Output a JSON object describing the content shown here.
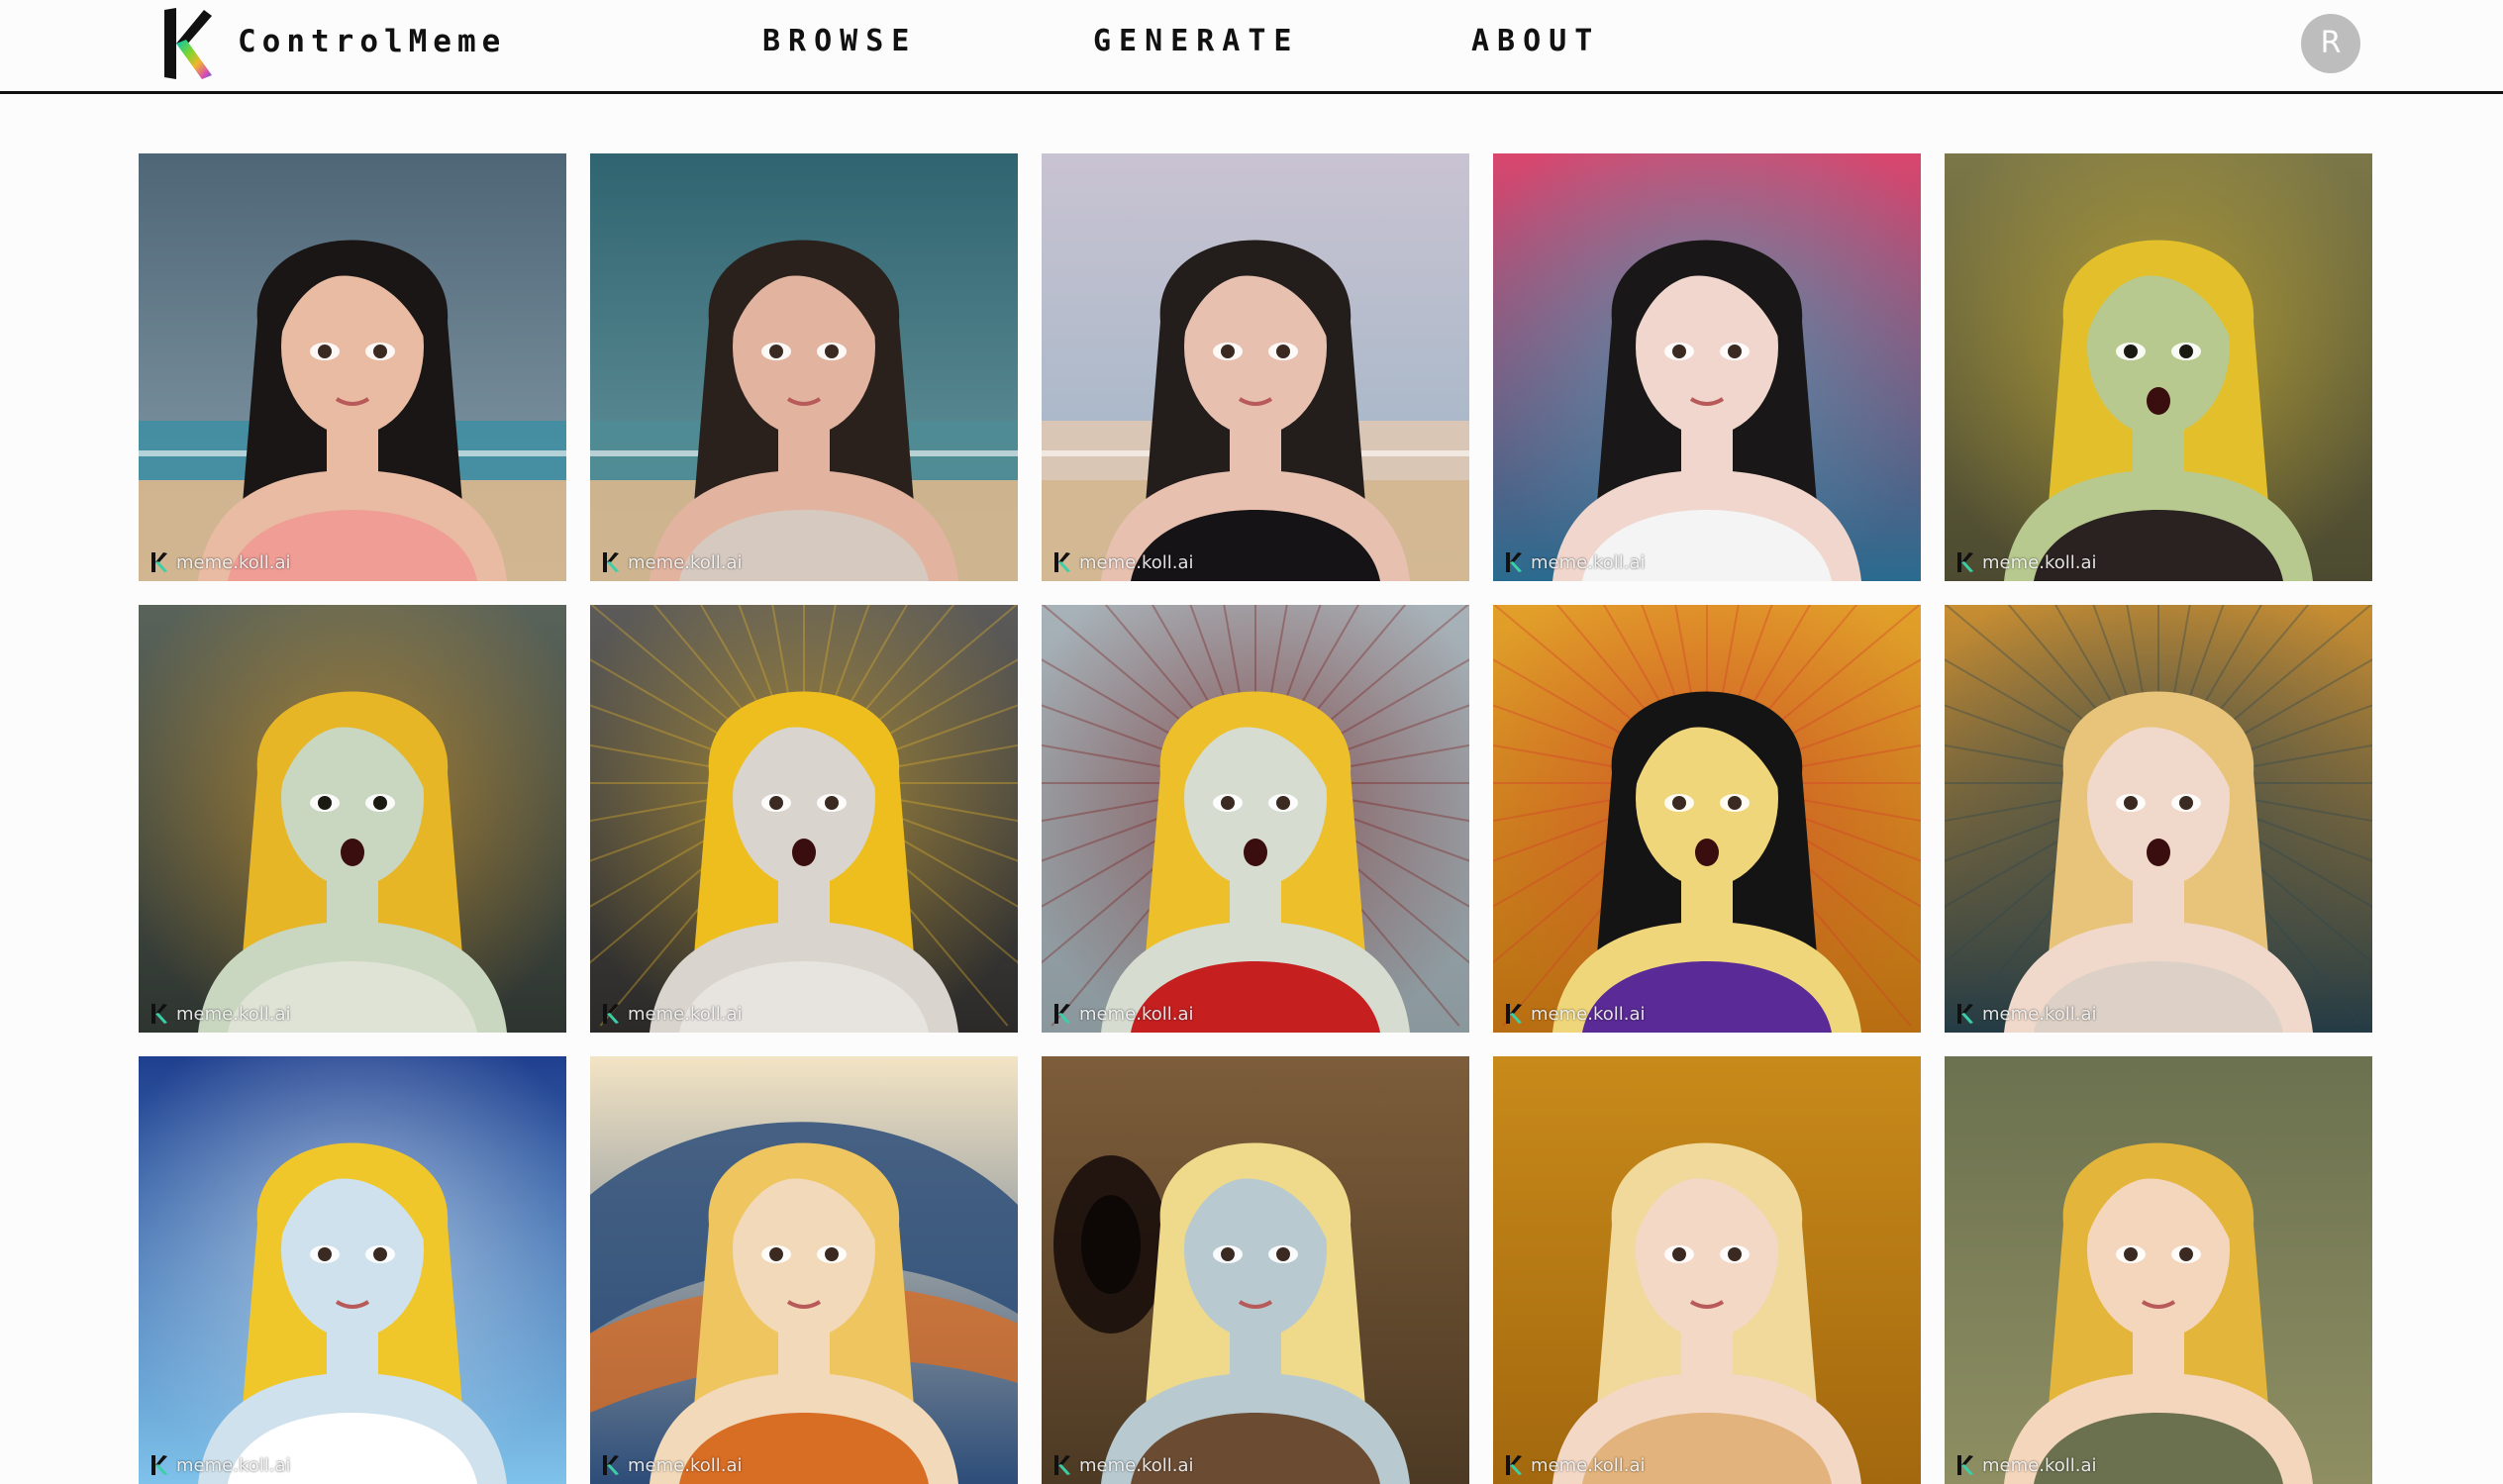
{
  "header": {
    "brand": "ControlMeme",
    "nav": [
      "BROWSE",
      "GENERATE",
      "ABOUT"
    ],
    "avatar_initial": "R"
  },
  "gallery": {
    "watermark": "meme.koll.ai",
    "items": [
      {
        "bg_top": "#4f6677",
        "bg_bottom": "#8aa0ad",
        "skin": "#e8bba2",
        "hair": "#1a1616",
        "shirt": "#ef9d95",
        "accent": "#3a8fa3",
        "scene": "beach"
      },
      {
        "bg_top": "#2f6470",
        "bg_bottom": "#6c9aa1",
        "skin": "#e2b49f",
        "hair": "#2a211d",
        "shirt": "#d6c9bf",
        "accent": "#4e8c95",
        "scene": "beach"
      },
      {
        "bg_top": "#c9c3d2",
        "bg_bottom": "#9ab3c4",
        "skin": "#e7c0b0",
        "hair": "#231d1b",
        "shirt": "#161316",
        "accent": "#e6c9b0",
        "scene": "beach"
      },
      {
        "bg_top": "#d9466e",
        "bg_bottom": "#2a6b8f",
        "skin": "#f0d6cc",
        "hair": "#1a1718",
        "shirt": "#f4f4f4",
        "accent": "#37b3c9",
        "scene": "studio"
      },
      {
        "bg_top": "#7b7748",
        "bg_bottom": "#4c4a30",
        "skin": "#b7c98e",
        "hair": "#e3c02b",
        "shirt": "#2a2220",
        "accent": "#e3c02b",
        "scene": "zombie"
      },
      {
        "bg_top": "#59635a",
        "bg_bottom": "#2e3530",
        "skin": "#c9d6c0",
        "hair": "#e7b626",
        "shirt": "#dfe3d6",
        "accent": "#f0a31f",
        "scene": "zombie"
      },
      {
        "bg_top": "#5c5b59",
        "bg_bottom": "#2b2a28",
        "skin": "#d9d4ce",
        "hair": "#edbe1e",
        "shirt": "#e7e4e0",
        "accent": "#e6b52a",
        "scene": "scream"
      },
      {
        "bg_top": "#a7b2b8",
        "bg_bottom": "#8a979c",
        "skin": "#d6dcd0",
        "hair": "#edbf2a",
        "shirt": "#c51f20",
        "accent": "#7a1b1b",
        "scene": "scream"
      },
      {
        "bg_top": "#e2a02a",
        "bg_bottom": "#b86d12",
        "skin": "#f0d67b",
        "hair": "#151414",
        "shirt": "#5a2a96",
        "accent": "#d33a2b",
        "scene": "hood"
      },
      {
        "bg_top": "#c98e32",
        "bg_bottom": "#243b45",
        "skin": "#f0d9cb",
        "hair": "#e8c47a",
        "shirt": "#ddd0c6",
        "accent": "#2b4651",
        "scene": "scream"
      },
      {
        "bg_top": "#1f3f8f",
        "bg_bottom": "#7fc2ea",
        "skin": "#cfe1ec",
        "hair": "#f0c72b",
        "shirt": "#ffffff",
        "accent": "#e6f2f8",
        "scene": "glow"
      },
      {
        "bg_top": "#f3e4c4",
        "bg_bottom": "#2d4d79",
        "skin": "#f1d9b9",
        "hair": "#eec55f",
        "shirt": "#d86d24",
        "accent": "#2d4d79",
        "scene": "swirl"
      },
      {
        "bg_top": "#7d5d3a",
        "bg_bottom": "#4d3a24",
        "skin": "#b8cad0",
        "hair": "#efd98a",
        "shirt": "#6b4c33",
        "accent": "#1a0e0b",
        "scene": "monster"
      },
      {
        "bg_top": "#c88a1a",
        "bg_bottom": "#a3680e",
        "skin": "#f3d8c6",
        "hair": "#f0d99b",
        "shirt": "#e2b37c",
        "accent": "#d79a2a",
        "scene": "plain"
      },
      {
        "bg_top": "#6b714f",
        "bg_bottom": "#8e8e62",
        "skin": "#f4d6bd",
        "hair": "#e4b53b",
        "shirt": "#6b714f",
        "accent": "#b29a43",
        "scene": "plain"
      }
    ]
  }
}
